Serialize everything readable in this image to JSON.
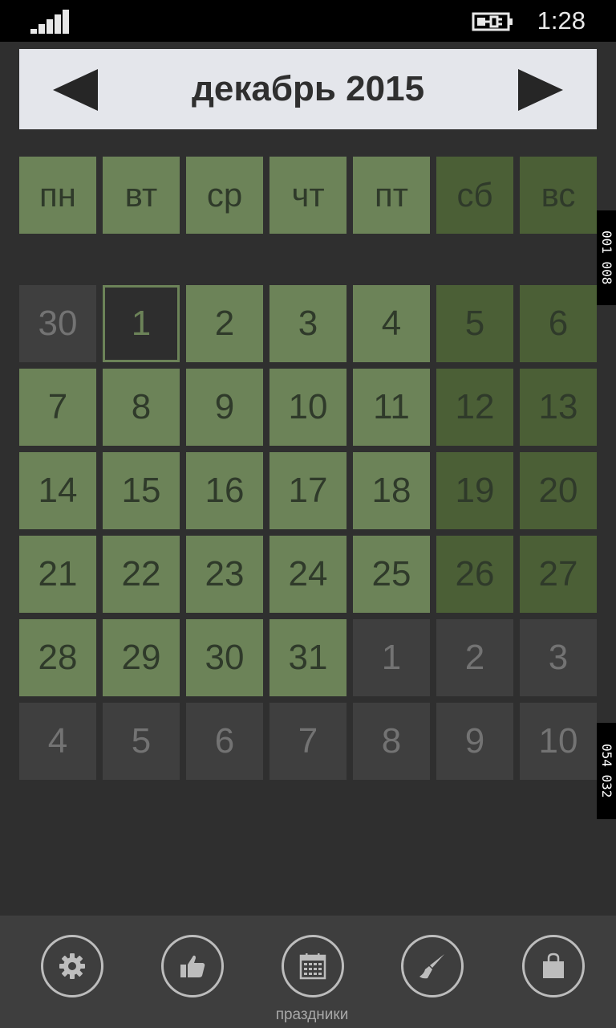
{
  "status_bar": {
    "signal_icon": "signal-strength-icon",
    "battery_icon": "battery-charging-icon",
    "time": "1:28"
  },
  "header": {
    "prev_icon": "triangle-left-icon",
    "next_icon": "triangle-right-icon",
    "title": "декабрь 2015"
  },
  "weekdays": [
    "пн",
    "вт",
    "ср",
    "чт",
    "пт",
    "сб",
    "вс"
  ],
  "weeks": [
    [
      "30",
      "1",
      "2",
      "3",
      "4",
      "5",
      "6"
    ],
    [
      "7",
      "8",
      "9",
      "10",
      "11",
      "12",
      "13"
    ],
    [
      "14",
      "15",
      "16",
      "17",
      "18",
      "19",
      "20"
    ],
    [
      "21",
      "22",
      "23",
      "24",
      "25",
      "26",
      "27"
    ],
    [
      "28",
      "29",
      "30",
      "31",
      "1",
      "2",
      "3"
    ],
    [
      "4",
      "5",
      "6",
      "7",
      "8",
      "9",
      "10"
    ]
  ],
  "today": "1",
  "side_labels": {
    "top": "001 008",
    "bottom": "054 032"
  },
  "colors": {
    "weekday_cell": "#6c8358",
    "weekend_cell": "#4b5f36",
    "other_month_cell": "#3f3f3f",
    "background": "#2f2f2f"
  },
  "app_bar": {
    "buttons": [
      {
        "icon": "gear-icon"
      },
      {
        "icon": "thumbs-up-icon"
      },
      {
        "icon": "calendar-icon",
        "label": "праздники"
      },
      {
        "icon": "brush-icon"
      },
      {
        "icon": "shopping-bag-icon"
      }
    ]
  }
}
